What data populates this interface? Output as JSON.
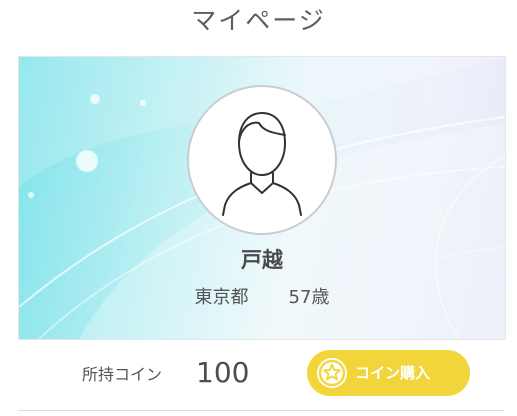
{
  "header": {
    "title": "マイページ"
  },
  "profile": {
    "avatar_icon": "user-silhouette-icon",
    "name": "戸越",
    "prefecture": "東京都",
    "age": "57歳"
  },
  "coins": {
    "label": "所持コイン",
    "value": "100",
    "buy_label": "コイン購入",
    "buy_icon": "star-icon",
    "button_color": "#f2d53b"
  }
}
